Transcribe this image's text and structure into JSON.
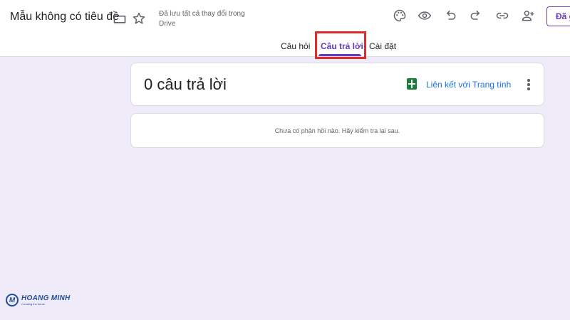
{
  "header": {
    "title": "Mẫu không có tiêu đề",
    "save_status": "Đã lưu tất cả thay đổi trong Drive",
    "send_label": "Đã gửi",
    "icons": [
      "folder-icon",
      "star-icon",
      "palette-icon",
      "eye-icon",
      "undo-icon",
      "redo-icon",
      "link-icon",
      "add-person-icon"
    ]
  },
  "tabs": [
    {
      "label": "Câu hỏi",
      "active": false
    },
    {
      "label": "Câu trả lời",
      "active": true
    },
    {
      "label": "Cài đặt",
      "active": false
    }
  ],
  "responses": {
    "count_text": "0 câu trả lời",
    "link_sheets_label": "Liên kết với Trang tính",
    "empty_message": "Chưa có phản hồi nào. Hãy kiểm tra lại sau."
  },
  "watermark": {
    "logo_letter": "M",
    "name": "HOANG MINH",
    "tagline": "Creating the future"
  },
  "colors": {
    "accent": "#673ab7",
    "background": "#f0ebf8",
    "link": "#1a73e8",
    "sheets_green": "#188038",
    "highlight": "#e02b2b"
  }
}
